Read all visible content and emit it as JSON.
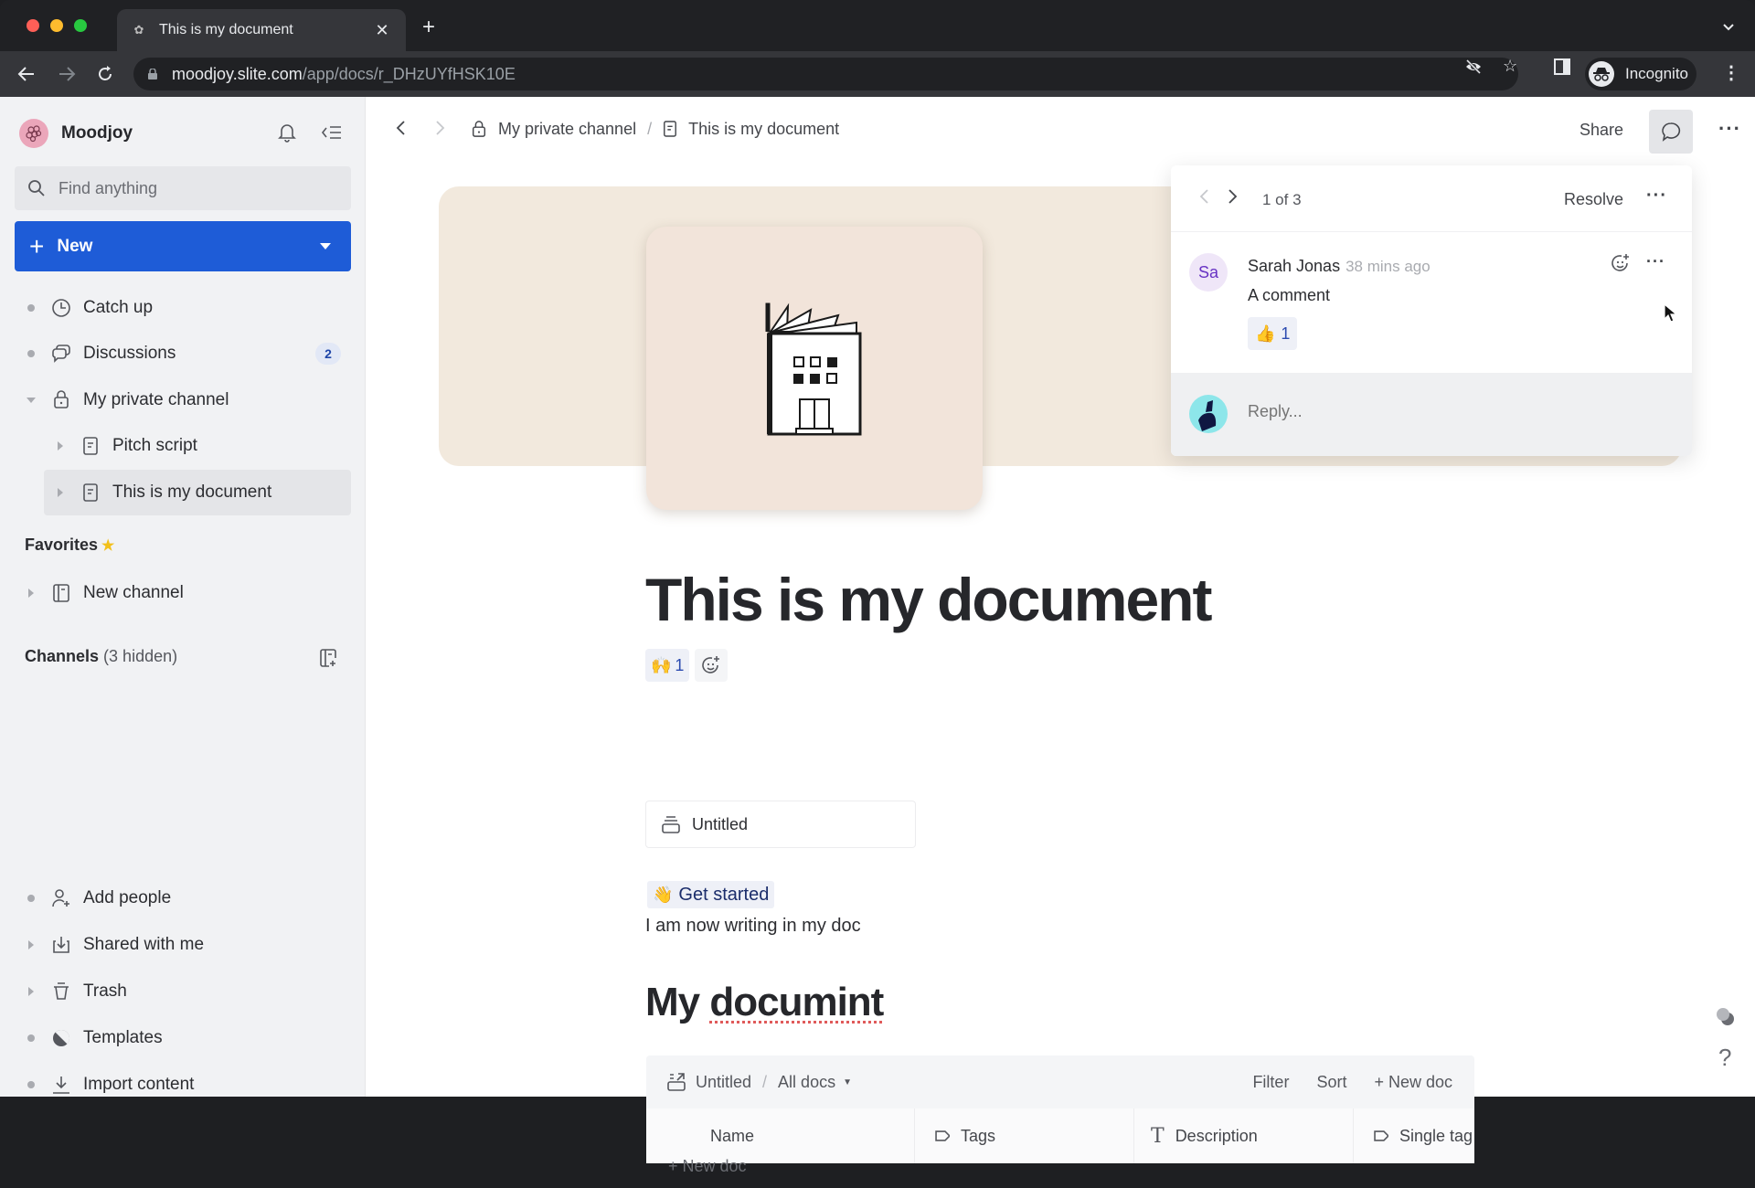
{
  "browser": {
    "tab_title": "This is my document",
    "url_host": "moodjoy.slite.com",
    "url_path": "/app/docs/r_DHzUYfHSK10E",
    "profile_label": "Incognito"
  },
  "sidebar": {
    "workspace_name": "Moodjoy",
    "search_placeholder": "Find anything",
    "new_button_label": "New",
    "nav": [
      {
        "label": "Catch up",
        "icon": "clock-icon"
      },
      {
        "label": "Discussions",
        "icon": "chat-bubbles-icon",
        "badge": "2"
      },
      {
        "label": "My private channel",
        "icon": "lock-icon",
        "expanded": true
      },
      {
        "label": "Pitch script",
        "icon": "document-icon"
      },
      {
        "label": "This is my document",
        "icon": "document-icon",
        "selected": true
      }
    ],
    "favorites_title": "Favorites",
    "favorites": [
      {
        "label": "New channel",
        "icon": "channel-icon"
      }
    ],
    "channels_title": "Channels",
    "channels_hidden": "(3 hidden)",
    "footer": [
      {
        "label": "Add people",
        "icon": "add-person-icon"
      },
      {
        "label": "Shared with me",
        "icon": "inbox-download-icon"
      },
      {
        "label": "Trash",
        "icon": "trash-icon"
      },
      {
        "label": "Templates",
        "icon": "templates-icon"
      },
      {
        "label": "Import content",
        "icon": "import-icon"
      }
    ]
  },
  "header": {
    "breadcrumb": [
      {
        "label": "My private channel",
        "icon": "lock-icon"
      },
      {
        "label": "This is my document",
        "icon": "document-icon"
      }
    ],
    "share_label": "Share"
  },
  "document": {
    "title": "This is my document",
    "reaction": {
      "emoji": "🙌",
      "count": "1"
    },
    "collection_ref": "Untitled",
    "get_started": {
      "emoji": "👋",
      "label": "Get started"
    },
    "paragraph": "I am now writing in my doc",
    "heading2_prefix": "My",
    "heading2_misspelled": "documint",
    "database": {
      "collection": "Untitled",
      "view": "All docs",
      "actions": [
        "Filter",
        "Sort",
        "+ New doc"
      ],
      "columns": [
        {
          "label": "Name",
          "icon": ""
        },
        {
          "label": "Tags",
          "icon": "tag-icon"
        },
        {
          "label": "Description",
          "icon": "text-icon"
        },
        {
          "label": "Single tag",
          "icon": "tag-icon"
        }
      ],
      "new_doc_label": "+ New doc"
    }
  },
  "comments": {
    "position": "1 of 3",
    "resolve_label": "Resolve",
    "thread": [
      {
        "initials": "Sa",
        "author": "Sarah Jonas",
        "time": "38 mins ago",
        "text": "A comment",
        "reaction": {
          "emoji": "👍",
          "count": "1"
        }
      }
    ],
    "reply_placeholder": "Reply..."
  },
  "floating": {
    "help_label": "?"
  }
}
